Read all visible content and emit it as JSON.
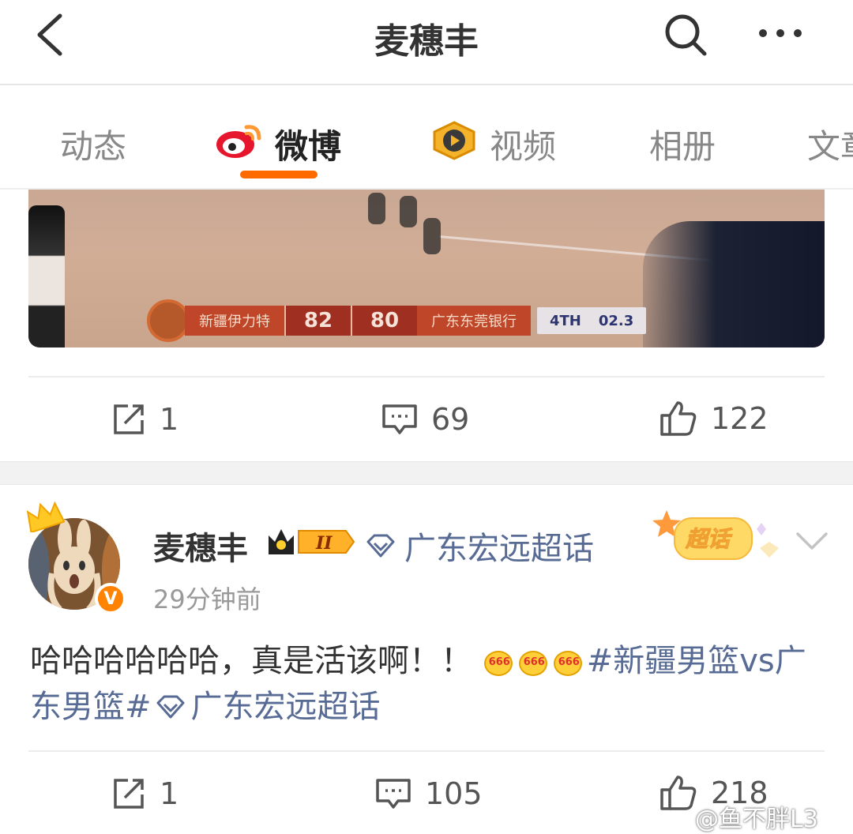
{
  "header": {
    "title": "麦穗丰"
  },
  "tabs": [
    {
      "label": "动态",
      "active": false
    },
    {
      "label": "微博",
      "active": true
    },
    {
      "label": "视频",
      "active": false
    },
    {
      "label": "相册",
      "active": false
    },
    {
      "label": "文章",
      "active": false
    }
  ],
  "video": {
    "team_left": "新疆伊力特",
    "score_left": "82",
    "score_right": "80",
    "team_right": "广东东莞银行",
    "period": "4TH",
    "clock": "02.3"
  },
  "post1_actions": {
    "repost_count": "1",
    "comment_count": "69",
    "like_count": "122"
  },
  "post2": {
    "username": "麦穗丰",
    "level_badge": "II",
    "topic": "广东宏远超话",
    "chaohua_badge": "超话",
    "time": "29分钟前",
    "text_main": "哈哈哈哈哈哈，真是活该啊！！",
    "emoji_label": "666",
    "hashtag": "#新疆男篮vs广东男篮#",
    "topic_link": "广东宏远超话",
    "actions": {
      "repost_count": "1",
      "comment_count": "105",
      "like_count": "218"
    }
  },
  "watermark": "@鱼不胖L3",
  "colors": {
    "accent": "#ff6a00",
    "link": "#576b95",
    "verified": "#ff8200"
  }
}
